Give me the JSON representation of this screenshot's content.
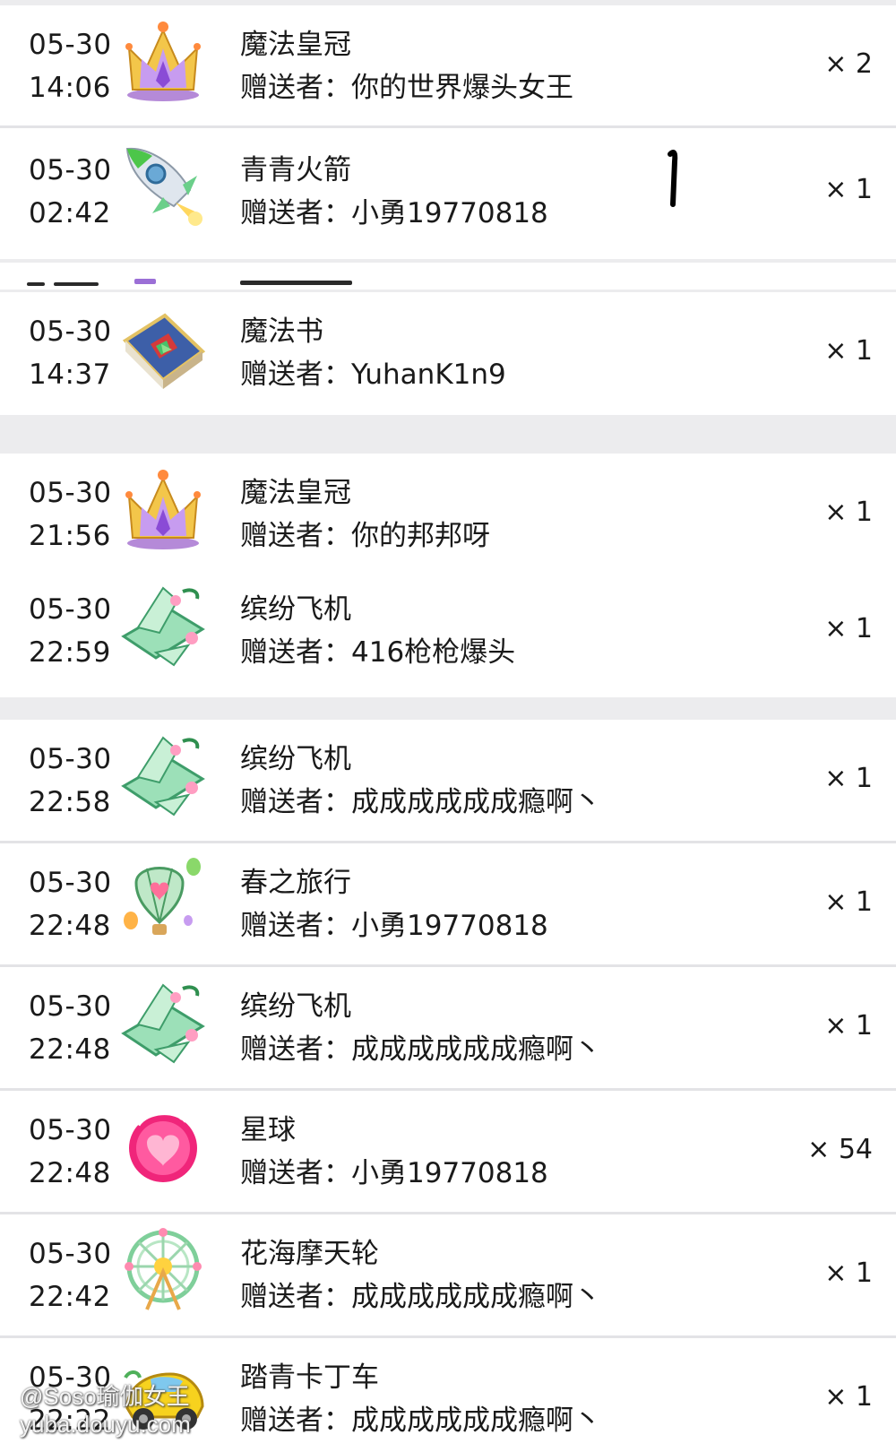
{
  "records": [
    {
      "date": "05-30",
      "time": "14:06",
      "gift": "魔法皇冠",
      "sender_label": "赠送者：",
      "sender": "你的世界爆头女王",
      "qty": "× 2",
      "icon": "crown-icon"
    },
    {
      "date": "05-30",
      "time": "02:42",
      "gift": "青青火箭",
      "sender_label": "赠送者：",
      "sender": "小勇19770818",
      "qty": "× 1",
      "icon": "rocket-icon"
    },
    {
      "date": "05-30",
      "time": "14:37",
      "gift": "魔法书",
      "sender_label": "赠送者：",
      "sender": "YuhanK1n9",
      "qty": "× 1",
      "icon": "magic-book-icon"
    },
    {
      "date": "05-30",
      "time": "21:56",
      "gift": "魔法皇冠",
      "sender_label": "赠送者：",
      "sender": "你的邦邦呀",
      "qty": "× 1",
      "icon": "crown-icon"
    },
    {
      "date": "05-30",
      "time": "22:59",
      "gift": "缤纷飞机",
      "sender_label": "赠送者：",
      "sender": "416枪枪爆头",
      "qty": "× 1",
      "icon": "airplane-icon"
    },
    {
      "date": "05-30",
      "time": "22:58",
      "gift": "缤纷飞机",
      "sender_label": "赠送者：",
      "sender": "成成成成成成瘾啊丶",
      "qty": "× 1",
      "icon": "airplane-icon"
    },
    {
      "date": "05-30",
      "time": "22:48",
      "gift": "春之旅行",
      "sender_label": "赠送者：",
      "sender": "小勇19770818",
      "qty": "× 1",
      "icon": "balloon-icon"
    },
    {
      "date": "05-30",
      "time": "22:48",
      "gift": "缤纷飞机",
      "sender_label": "赠送者：",
      "sender": "成成成成成成瘾啊丶",
      "qty": "× 1",
      "icon": "airplane-icon"
    },
    {
      "date": "05-30",
      "time": "22:48",
      "gift": "星球",
      "sender_label": "赠送者：",
      "sender": "小勇19770818",
      "qty": "× 54",
      "icon": "planet-heart-icon"
    },
    {
      "date": "05-30",
      "time": "22:42",
      "gift": "花海摩天轮",
      "sender_label": "赠送者：",
      "sender": "成成成成成成瘾啊丶",
      "qty": "× 1",
      "icon": "ferris-wheel-icon"
    },
    {
      "date": "05-30",
      "time": "22:22",
      "gift": "踏青卡丁车",
      "sender_label": "赠送者：",
      "sender": "成成成成成成瘾啊丶",
      "qty": "× 1",
      "icon": "kart-icon"
    }
  ],
  "watermark": {
    "line1": "@Soso瑜伽女王",
    "line2": "yuba.douyu.com"
  },
  "colors": {
    "background": "#ececee",
    "panel": "#ffffff",
    "divider": "#e3e3e6",
    "text": "#1a1a1a"
  }
}
